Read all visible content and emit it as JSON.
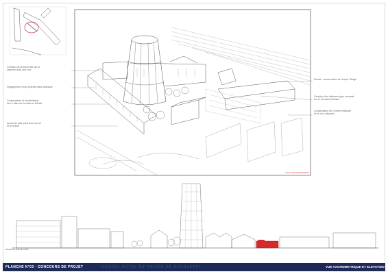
{
  "annotations_left": [
    "Création de la 5ème aile de la\ncaserne avec une tour",
    "Dégagement d'une grande place publique",
    "Conservation et réhabilitation\ndes 2 ailes de la caserne Defeld",
    "Accès de plain pied avec la rue\net le trottoir"
  ],
  "annotations_right": [
    "Densé : conservation de l'esprit 'village'",
    "Création d'un bâtiment type 'nomade'\nsur le toit avec terrasse",
    "Conservation de l'entrée existante\net du mur adjacent"
  ],
  "axo_caption": "VUE AXONOMETRIQUE",
  "elevation_caption": "ELEVATION RUE DE  1/1000",
  "footer": {
    "left": "PLANCHE N°03 - CONCOURS DE PROJET",
    "middle": "NOUVEL HOTEL DE POLICE DE CHARLEROI",
    "right": "VUE AXONOMETRIQUE ET ELEVATION"
  },
  "colors": {
    "footer_bg": "#1d2a55",
    "accent_red": "#d42a2a",
    "line": "#555555"
  }
}
